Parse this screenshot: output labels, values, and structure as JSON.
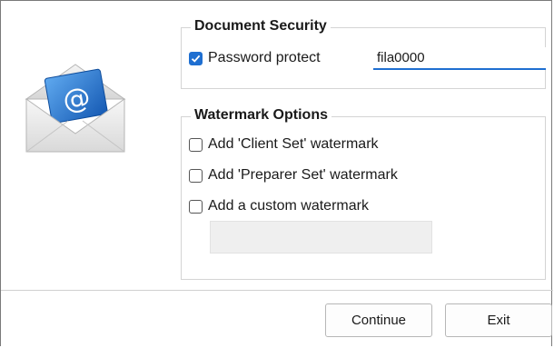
{
  "security_group": {
    "title": "Document Security",
    "password_protect": {
      "label": "Password protect",
      "checked": true
    },
    "password_value": "fila0000"
  },
  "watermark_group": {
    "title": "Watermark Options",
    "options": [
      {
        "label": "Add 'Client Set' watermark",
        "checked": false
      },
      {
        "label": "Add 'Preparer Set' watermark",
        "checked": false
      },
      {
        "label": "Add a custom watermark",
        "checked": false
      }
    ],
    "custom_watermark_value": ""
  },
  "buttons": {
    "continue_label": "Continue",
    "exit_label": "Exit"
  },
  "icons": {
    "envelope": "email-envelope-icon"
  },
  "colors": {
    "accent": "#1f6fd1"
  }
}
